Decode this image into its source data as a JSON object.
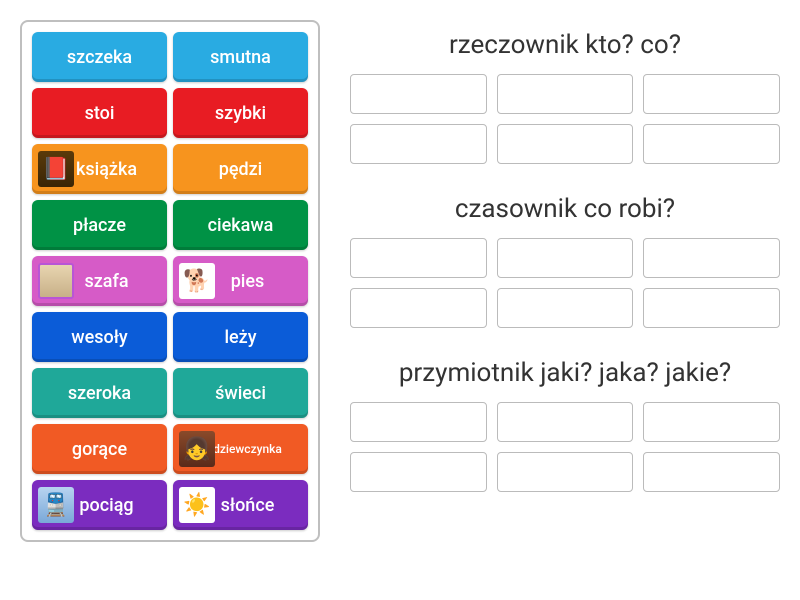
{
  "tiles": [
    {
      "label": "szczeka",
      "color": "blue",
      "icon": null
    },
    {
      "label": "smutna",
      "color": "blue",
      "icon": null
    },
    {
      "label": "stoi",
      "color": "red",
      "icon": null
    },
    {
      "label": "szybki",
      "color": "red",
      "icon": null
    },
    {
      "label": "książka",
      "color": "orange",
      "icon": "book"
    },
    {
      "label": "pędzi",
      "color": "orange",
      "icon": null
    },
    {
      "label": "płacze",
      "color": "green",
      "icon": null
    },
    {
      "label": "ciekawa",
      "color": "green",
      "icon": null
    },
    {
      "label": "szafa",
      "color": "pink",
      "icon": "wardrobe"
    },
    {
      "label": "pies",
      "color": "pink",
      "icon": "dog"
    },
    {
      "label": "wesoły",
      "color": "darkblue",
      "icon": null
    },
    {
      "label": "leży",
      "color": "darkblue",
      "icon": null
    },
    {
      "label": "szeroka",
      "color": "teal",
      "icon": null
    },
    {
      "label": "świeci",
      "color": "teal",
      "icon": null
    },
    {
      "label": "gorące",
      "color": "orangered",
      "icon": null
    },
    {
      "label": "dziewczynka",
      "color": "orangered",
      "icon": "girl",
      "small": true
    },
    {
      "label": "pociąg",
      "color": "purple",
      "icon": "train"
    },
    {
      "label": "słońce",
      "color": "purple",
      "icon": "sun"
    }
  ],
  "categories": [
    {
      "title": "rzeczownik kto? co?",
      "slots": 6
    },
    {
      "title": "czasownik co robi?",
      "slots": 6
    },
    {
      "title": "przymiotnik jaki? jaka? jakie?",
      "slots": 6
    }
  ],
  "icons": {
    "book": "📕",
    "wardrobe": "",
    "dog": "🐕",
    "girl": "👧",
    "train": "🚆",
    "sun": "☀️"
  }
}
